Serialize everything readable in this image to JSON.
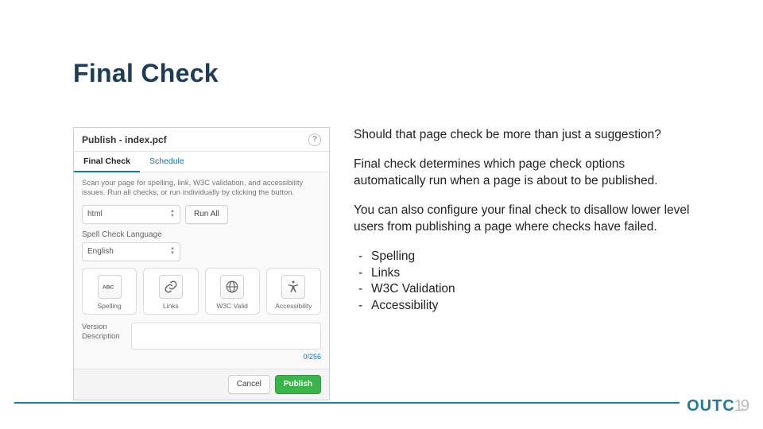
{
  "title": "Final Check",
  "dialog": {
    "title": "Publish - index.pcf",
    "help_glyph": "?",
    "tabs": {
      "active": "Final Check",
      "other": "Schedule"
    },
    "description": "Scan your page for spelling, link, W3C validation, and accessibility issues. Run all checks, or run individually by clicking the button.",
    "output_select": "html",
    "run_all_label": "Run All",
    "spellcheck_section_label": "Spell Check Language",
    "spellcheck_select": "English",
    "tiles": [
      {
        "label": "Spelling",
        "icon": "abc-icon"
      },
      {
        "label": "Links",
        "icon": "link-icon"
      },
      {
        "label": "W3C Valid",
        "icon": "globe-icon"
      },
      {
        "label": "Accessibility",
        "icon": "accessibility-icon"
      }
    ],
    "version_label_line1": "Version",
    "version_label_line2": "Description",
    "char_count": "0/256",
    "cancel_label": "Cancel",
    "publish_label": "Publish"
  },
  "body": {
    "p1": "Should that page check be more than just a suggestion?",
    "p2": "Final check determines which page check options automatically run when a page is about to be published.",
    "p3": "You can also configure your final check to disallow lower level users from publishing a page where checks have failed.",
    "bullets": [
      "Spelling",
      "Links",
      "W3C Validation",
      "Accessibility"
    ]
  },
  "footer": {
    "brand_prefix": "OUTC",
    "pagenum": "19"
  }
}
